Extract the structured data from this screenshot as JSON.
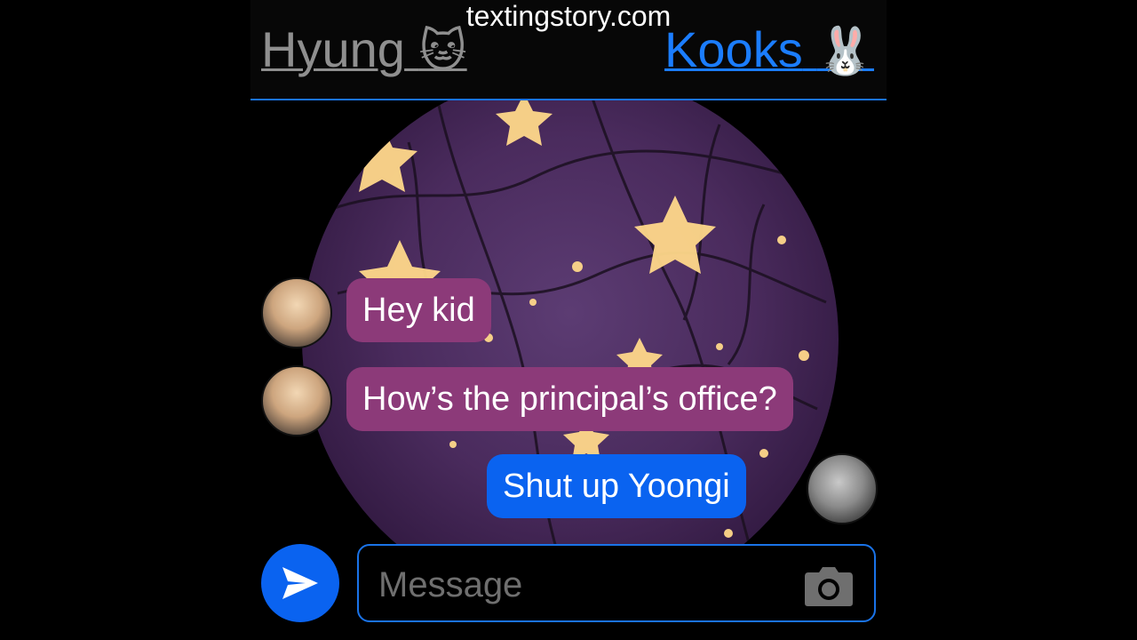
{
  "watermark": "textingstory.com",
  "header": {
    "left_contact": {
      "name": "Hyung",
      "emoji": "🐱"
    },
    "right_contact": {
      "name": "Kooks",
      "emoji": "🐰"
    },
    "accent_color": "#1b7dff"
  },
  "messages": [
    {
      "text": "Hey kid",
      "direction": "incoming",
      "color": "#8c3a79"
    },
    {
      "text": "How’s the principal’s office?",
      "direction": "incoming",
      "color": "#8c3a79"
    },
    {
      "text": "Shut up Yoongi",
      "direction": "outgoing",
      "color": "#0a63f0"
    }
  ],
  "composer": {
    "placeholder": "Message",
    "send_icon": "paper-plane-icon",
    "camera_icon": "camera-icon"
  }
}
